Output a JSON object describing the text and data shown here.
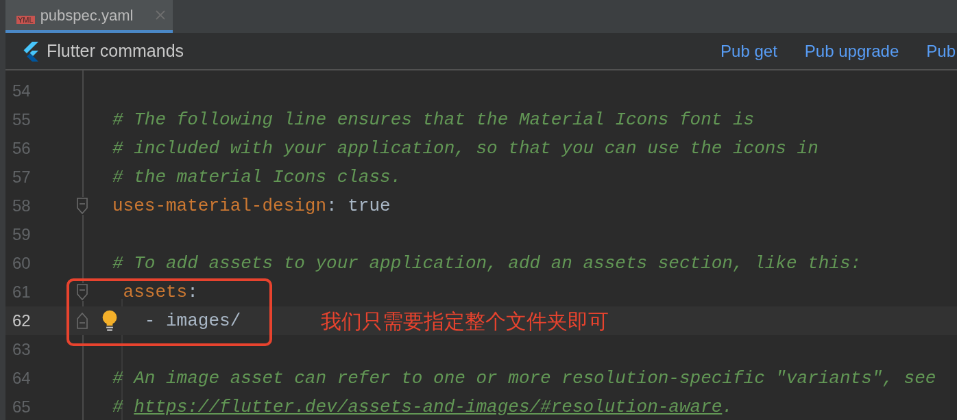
{
  "tab": {
    "label": "pubspec.yaml",
    "badge": "YML",
    "selected": true
  },
  "toolbar": {
    "title": "Flutter commands",
    "actions": [
      "Pub get",
      "Pub upgrade",
      "Pub"
    ]
  },
  "editor": {
    "lines": [
      {
        "number": "54",
        "current": false
      },
      {
        "number": "55",
        "current": false,
        "tokens": [
          {
            "kind": "comment",
            "text": "# The following line ensures that the Material Icons font is"
          }
        ]
      },
      {
        "number": "56",
        "current": false,
        "tokens": [
          {
            "kind": "comment",
            "text": "# included with your application, so that you can use the icons in"
          }
        ]
      },
      {
        "number": "57",
        "current": false,
        "tokens": [
          {
            "kind": "comment",
            "text": "# the material Icons class."
          }
        ]
      },
      {
        "number": "58",
        "current": false,
        "fold_start": true,
        "tokens": [
          {
            "kind": "key",
            "text": "uses-material-design"
          },
          {
            "kind": "plain",
            "text": ": true"
          }
        ]
      },
      {
        "number": "59",
        "current": false
      },
      {
        "number": "60",
        "current": false,
        "tokens": [
          {
            "kind": "comment",
            "text": "# To add assets to your application, add an assets section, like this:"
          }
        ]
      },
      {
        "number": "61",
        "current": false,
        "fold_start": true,
        "tokens": [
          {
            "kind": "key",
            "text": " assets"
          },
          {
            "kind": "plain",
            "text": ":"
          }
        ]
      },
      {
        "number": "62",
        "current": true,
        "fold_end": true,
        "bulb": true,
        "tokens": [
          {
            "kind": "plain",
            "text": "   - images/"
          }
        ]
      },
      {
        "number": "63",
        "current": false
      },
      {
        "number": "64",
        "current": false,
        "tokens": [
          {
            "kind": "comment",
            "text": "# An image asset can refer to one or more resolution-specific \"variants\", see"
          }
        ]
      },
      {
        "number": "65",
        "current": false,
        "tokens": [
          {
            "kind": "comment",
            "text": "# "
          },
          {
            "kind": "link",
            "text": "https://flutter.dev/assets-and-images/#resolution-aware"
          },
          {
            "kind": "comment",
            "text": "."
          }
        ]
      }
    ]
  },
  "annotation": {
    "text": "我们只需要指定整个文件夹即可"
  }
}
